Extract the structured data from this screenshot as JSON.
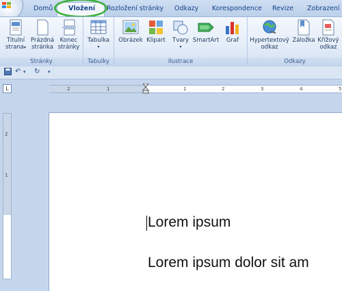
{
  "tabs": [
    {
      "label": "Domů"
    },
    {
      "label": "Vložení"
    },
    {
      "label": "Rozložení stránky"
    },
    {
      "label": "Odkazy"
    },
    {
      "label": "Korespondence"
    },
    {
      "label": "Revize"
    },
    {
      "label": "Zobrazení"
    }
  ],
  "groups": {
    "pages": {
      "label": "Stránky",
      "buttons": [
        "Titulní strana",
        "Prázdná stránka",
        "Konec stránky"
      ]
    },
    "tables": {
      "label": "Tabulky",
      "buttons": [
        "Tabulka"
      ]
    },
    "illustrations": {
      "label": "Ilustrace",
      "buttons": [
        "Obrázek",
        "Klipart",
        "Tvary",
        "SmartArt",
        "Graf"
      ]
    },
    "links": {
      "label": "Odkazy",
      "buttons": [
        "Hypertextový odkaz",
        "Záložka",
        "Křížový odkaz"
      ]
    }
  },
  "buttons": {
    "titulni": {
      "line1": "Titulní",
      "line2": "strana"
    },
    "prazdna": {
      "line1": "Prázdná",
      "line2": "stránka"
    },
    "konec": {
      "line1": "Konec",
      "line2": "stránky"
    },
    "tabulka": {
      "line1": "Tabulka"
    },
    "obrazek": {
      "line1": "Obrázek"
    },
    "klipart": {
      "line1": "Klipart"
    },
    "tvary": {
      "line1": "Tvary"
    },
    "smartart": {
      "line1": "SmartArt"
    },
    "graf": {
      "line1": "Graf"
    },
    "hypertext": {
      "line1": "Hypertextový",
      "line2": "odkaz"
    },
    "zalozka": {
      "line1": "Záložka"
    },
    "krizovy": {
      "line1": "Křížový",
      "line2": "odkaz"
    }
  },
  "ruler": {
    "ticks": [
      "2",
      "1",
      "1",
      "2",
      "3",
      "4",
      "5"
    ],
    "corner": "L"
  },
  "vruler": {
    "ticks": [
      "2",
      "1"
    ]
  },
  "document": {
    "line1": "Lorem ipsum",
    "line2": "Lorem ipsum dolor sit am"
  },
  "colors": {
    "highlight": "#3eb13e",
    "tab_text": "#15428b"
  }
}
